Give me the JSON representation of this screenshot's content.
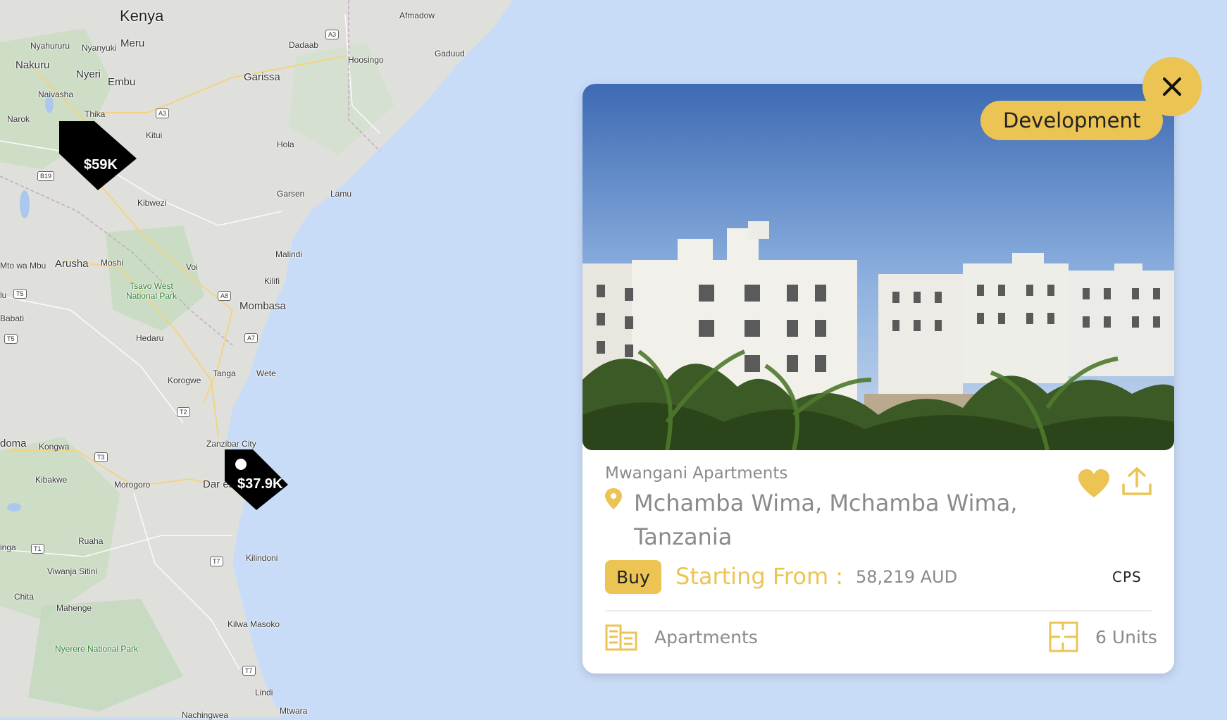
{
  "map": {
    "country_label": "Kenya",
    "places": [
      "Afmadow",
      "Dadaab",
      "Hoosingo",
      "Gaduud",
      "Nyahururu",
      "Nyanyuki",
      "Meru",
      "Nakuru",
      "Nyeri",
      "Embu",
      "Garissa",
      "Naivasha",
      "Thika",
      "Narok",
      "Kitui",
      "Hola",
      "Garsen",
      "Lamu",
      "Kibwezi",
      "Malindi",
      "Kilifi",
      "Mto wa Mbu",
      "Arusha",
      "Moshi",
      "Voi",
      "Mombasa",
      "Babati",
      "Hedaru",
      "Tanga",
      "Wete",
      "Korogwe",
      "Zanzibar City",
      "Kongwa",
      "Dar es",
      "Kibakwe",
      "Morogoro",
      "Ruaha",
      "Viwanja Sitini",
      "Kilindoni",
      "Chita",
      "Mahenge",
      "Kilwa Masoko",
      "Lindi",
      "Mtwara",
      "Nachingwea",
      "doma",
      "inga",
      "lu"
    ],
    "parks": [
      "Tsavo West National Park",
      "Nyerere National Park"
    ],
    "roads": [
      "A3",
      "A3",
      "A3",
      "B19",
      "A8",
      "A7",
      "T5",
      "T5",
      "T2",
      "T3",
      "T1",
      "T7",
      "T7"
    ],
    "markers": [
      {
        "label": "$59K"
      },
      {
        "label": "$37.9K"
      }
    ]
  },
  "card": {
    "badge": "Development",
    "close_icon": "close-icon",
    "property_name": "Mwangani Apartments",
    "address": "Mchamba Wima, Mchamba Wima, Tanzania",
    "listing_type": "Buy",
    "starting_from_label": "Starting From :",
    "price": "58,219 AUD",
    "agency_logo": "CPS",
    "property_type": "Apartments",
    "units": "6 Units",
    "colors": {
      "accent": "#ebc453",
      "muted_text": "#8a8a8a",
      "marker": "#000000"
    }
  }
}
